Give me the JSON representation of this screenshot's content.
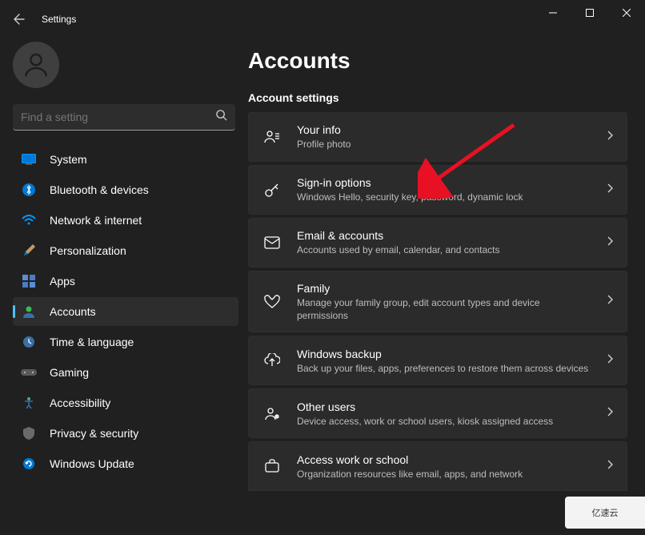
{
  "app": {
    "title": "Settings"
  },
  "search": {
    "placeholder": "Find a setting"
  },
  "sidebar": {
    "items": [
      {
        "label": "System"
      },
      {
        "label": "Bluetooth & devices"
      },
      {
        "label": "Network & internet"
      },
      {
        "label": "Personalization"
      },
      {
        "label": "Apps"
      },
      {
        "label": "Accounts"
      },
      {
        "label": "Time & language"
      },
      {
        "label": "Gaming"
      },
      {
        "label": "Accessibility"
      },
      {
        "label": "Privacy & security"
      },
      {
        "label": "Windows Update"
      }
    ]
  },
  "page": {
    "title": "Accounts",
    "section_title": "Account settings",
    "cards": [
      {
        "title": "Your info",
        "sub": "Profile photo"
      },
      {
        "title": "Sign-in options",
        "sub": "Windows Hello, security key, password, dynamic lock"
      },
      {
        "title": "Email & accounts",
        "sub": "Accounts used by email, calendar, and contacts"
      },
      {
        "title": "Family",
        "sub": "Manage your family group, edit account types and device permissions"
      },
      {
        "title": "Windows backup",
        "sub": "Back up your files, apps, preferences to restore them across devices"
      },
      {
        "title": "Other users",
        "sub": "Device access, work or school users, kiosk assigned access"
      },
      {
        "title": "Access work or school",
        "sub": "Organization resources like email, apps, and network"
      }
    ]
  },
  "watermark": {
    "text": "亿速云"
  }
}
